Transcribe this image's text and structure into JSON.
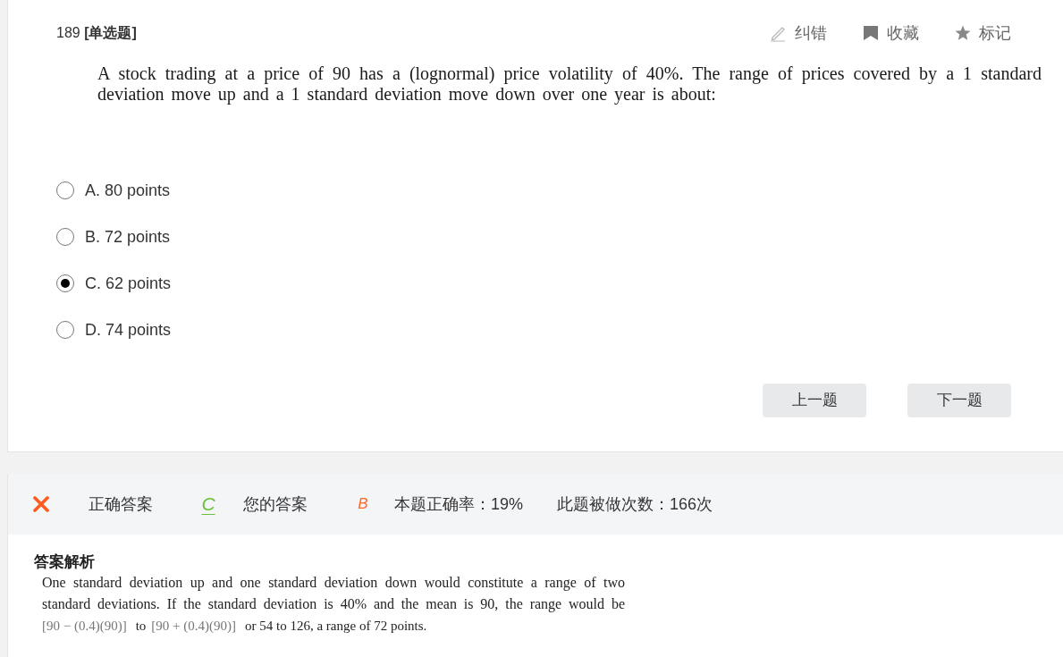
{
  "question": {
    "header": "189 **[单选题]**",
    "actions": [
      {
        "kind": "edit",
        "label": "纠错"
      },
      {
        "kind": "bookmark",
        "label": "收藏"
      },
      {
        "kind": "star",
        "label": "标记"
      }
    ],
    "text": "A stock trading at a price of 90 has a (lognormal) price volatility of 40%. The range of prices covered by a 1 standard deviation move up and a 1 standard deviation move down over one year is about:",
    "options": [
      {
        "label": "A. 80 points",
        "selected": false
      },
      {
        "label": "B. 72 points",
        "selected": false
      },
      {
        "label": "C. 62 points",
        "selected": true
      },
      {
        "label": "D. 74 points",
        "selected": false
      }
    ],
    "buttons": [
      "上一题",
      "下一题"
    ]
  },
  "result": {
    "correct": false,
    "answers": [
      {
        "label": "正确答案",
        "value": "C",
        "color": "#67c23a",
        "underlined": true
      },
      {
        "label": "您的答案",
        "value": "B",
        "color": "#ff6a2c",
        "underlined": false
      }
    ],
    "stats": [
      "本题正确率：19%",
      "此题被做次数：166次"
    ]
  },
  "explanation": {
    "title": "答案解析",
    "text": "One standard deviation up and one standard deviation down would constitute a range of two standard deviations. If the standard deviation is 40% and the mean is 90, the range would be",
    "line": [
      {
        "kind": "formula",
        "text": "[90 − (0.4)(90)]"
      },
      {
        "kind": "text",
        "text": "to"
      },
      {
        "kind": "formula",
        "text": "[90 + (0.4)(90)]"
      },
      {
        "kind": "text",
        "text": "or 54 to 126, a range of 72 points."
      }
    ]
  }
}
